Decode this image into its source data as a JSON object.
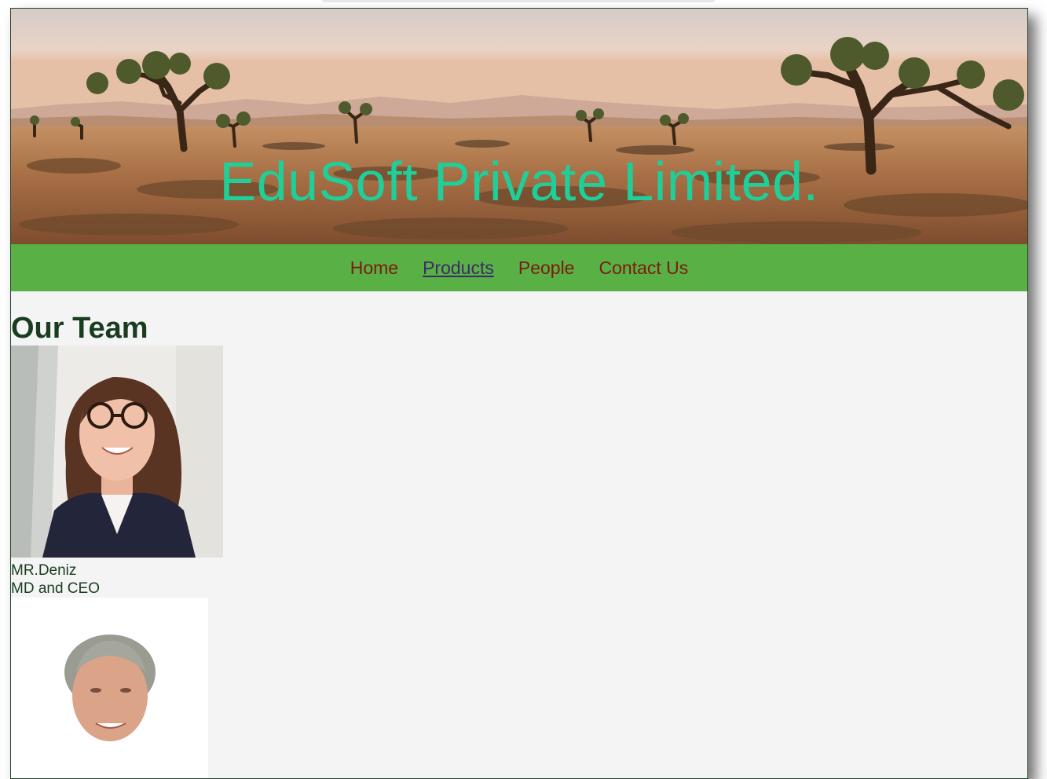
{
  "site": {
    "title": "EduSoft Private Limited."
  },
  "nav": {
    "items": [
      {
        "label": "Home",
        "active": false
      },
      {
        "label": "Products",
        "active": true
      },
      {
        "label": "People",
        "active": false
      },
      {
        "label": "Contact Us",
        "active": false
      }
    ]
  },
  "team": {
    "heading": "Our Team",
    "members": [
      {
        "name": "MR.Deniz",
        "role": "MD and CEO",
        "photo": "woman-with-glasses-portrait"
      },
      {
        "name": "",
        "role": "",
        "photo": "older-man-portrait"
      }
    ]
  },
  "colors": {
    "title": "#1ecf9a",
    "nav_bg": "#59b044",
    "nav_link": "#7c1a12",
    "nav_active": "#3c2a6e",
    "heading": "#1a3d1f",
    "page_bg": "#f4f4f4"
  },
  "banner": {
    "image": "desert-joshua-trees-landscape"
  }
}
